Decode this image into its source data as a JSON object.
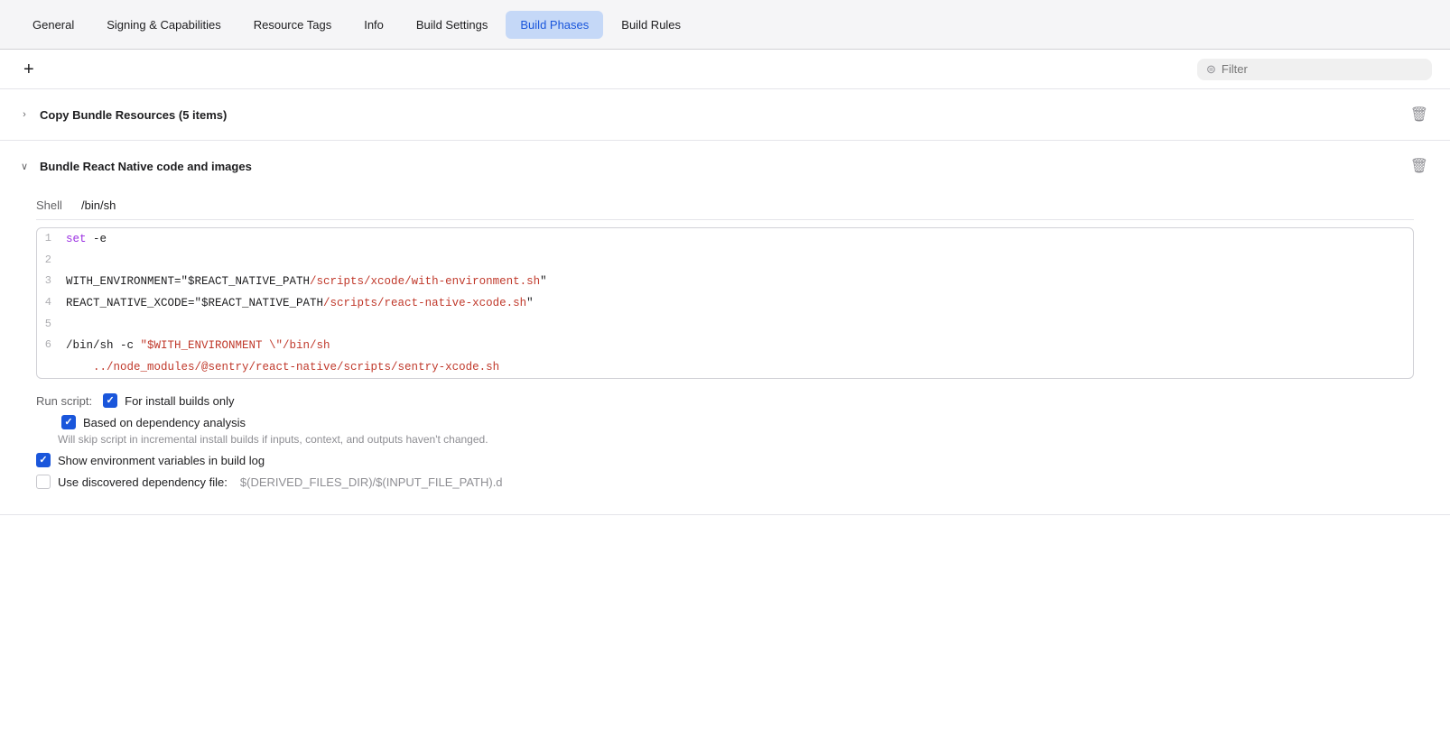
{
  "tabs": [
    {
      "id": "general",
      "label": "General",
      "active": false
    },
    {
      "id": "signing",
      "label": "Signing & Capabilities",
      "active": false
    },
    {
      "id": "resource-tags",
      "label": "Resource Tags",
      "active": false
    },
    {
      "id": "info",
      "label": "Info",
      "active": false
    },
    {
      "id": "build-settings",
      "label": "Build Settings",
      "active": false
    },
    {
      "id": "build-phases",
      "label": "Build Phases",
      "active": true
    },
    {
      "id": "build-rules",
      "label": "Build Rules",
      "active": false
    }
  ],
  "toolbar": {
    "add_label": "+",
    "filter_placeholder": "Filter"
  },
  "sections": [
    {
      "id": "copy-bundle",
      "title": "Copy Bundle Resources (5 items)",
      "expanded": false
    },
    {
      "id": "bundle-react-native",
      "title": "Bundle React Native code and images",
      "expanded": true
    }
  ],
  "shell": {
    "label": "Shell",
    "value": "/bin/sh"
  },
  "code_lines": [
    {
      "num": "1",
      "content": "set -e",
      "type": "set"
    },
    {
      "num": "2",
      "content": "",
      "type": "empty"
    },
    {
      "num": "3",
      "content": "WITH_ENVIRONMENT=\"$REACT_NATIVE_PATH/scripts/xcode/with-environment.sh\"",
      "type": "env"
    },
    {
      "num": "4",
      "content": "REACT_NATIVE_XCODE=\"$REACT_NATIVE_PATH/scripts/react-native-xcode.sh\"",
      "type": "env"
    },
    {
      "num": "5",
      "content": "",
      "type": "empty"
    },
    {
      "num": "6",
      "content": "/bin/sh -c \"$WITH_ENVIRONMENT \\\"/bin/sh",
      "type": "run"
    },
    {
      "num": "",
      "content": "    ../node_modules/@sentry/react-native/scripts/sentry-xcode.sh",
      "type": "run-cont"
    }
  ],
  "run_script": {
    "label": "Run script:",
    "option1_label": "For install builds only",
    "option1_checked": true,
    "option2_label": "Based on dependency analysis",
    "option2_checked": true,
    "option2_hint": "Will skip script in incremental install builds if inputs, context, and outputs haven't changed.",
    "option3_label": "Show environment variables in build log",
    "option3_checked": true,
    "option4_label": "Use discovered dependency file:",
    "option4_checked": false,
    "option4_value": "$(DERIVED_FILES_DIR)/$(INPUT_FILE_PATH).d"
  }
}
